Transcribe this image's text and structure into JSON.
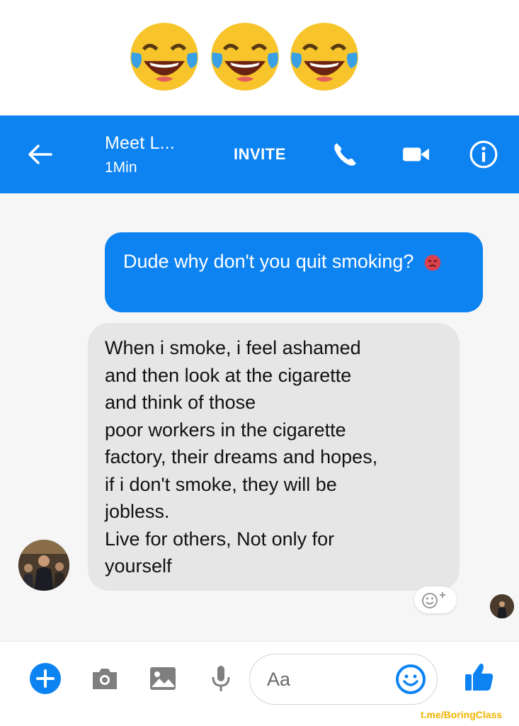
{
  "emojis": [
    "tears-of-joy-emoji",
    "tears-of-joy-emoji",
    "tears-of-joy-emoji"
  ],
  "header": {
    "contact_name": "Meet L...",
    "status": "1Min",
    "invite_label": "INVITE",
    "icons": [
      "back-arrow-icon",
      "phone-icon",
      "video-camera-icon",
      "info-icon"
    ],
    "background": "#0d83f2"
  },
  "messages": [
    {
      "direction": "outgoing",
      "text": "Dude why don't you quit smoking?",
      "emoji": "angry-face-emoji"
    },
    {
      "direction": "incoming",
      "text": "When i smoke, i feel ashamed\nand then look at the cigarette\nand think of those\npoor workers in the cigarette\nfactory, their dreams and hopes,\nif i don't smoke, they will be\njobless.\nLive for others, Not only for\nyourself"
    }
  ],
  "composer": {
    "placeholder": "Aa",
    "icons": [
      "plus-icon",
      "camera-icon",
      "image-icon",
      "microphone-icon",
      "emoji-icon",
      "thumbs-up-icon"
    ]
  },
  "watermark": "t.me/BoringClass",
  "colors": {
    "accent": "#0d83f2",
    "incoming_bubble": "#e6e6e6",
    "watermark": "#f0b400"
  }
}
